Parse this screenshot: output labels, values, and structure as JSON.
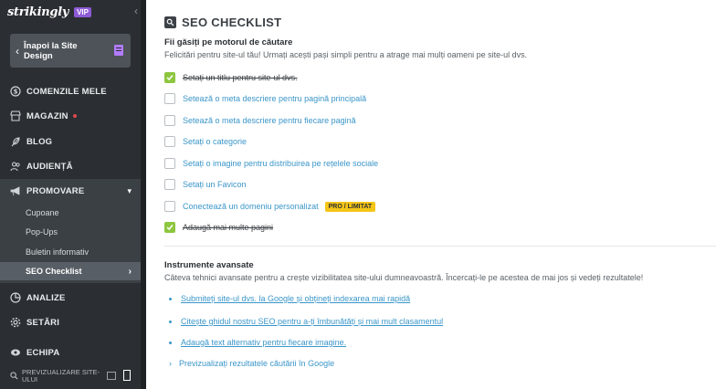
{
  "sidebar": {
    "brand": "strikingly",
    "vip": "VIP",
    "back_label": "Înapoi la Site Design",
    "nav": {
      "orders": "COMENZILE MELE",
      "store": "MAGAZIN",
      "blog": "BLOG",
      "audience": "AUDIENȚĂ",
      "promote": "PROMOVARE",
      "analytics": "ANALIZE",
      "settings": "SETĂRI",
      "team": "ECHIPA"
    },
    "promote_sub": [
      "Cupoane",
      "Pop-Ups",
      "Buletin informativ",
      "SEO Checklist"
    ],
    "preview_label": "PREVIZUALIZARE SITE-ULUI"
  },
  "main": {
    "title": "SEO CHECKLIST",
    "section1": {
      "title": "Fii găsiți pe motorul de căutare",
      "desc": "Felicitări pentru site-ul tău! Urmați acești pași simpli pentru a atrage mai mulți oameni pe site-ul dvs.",
      "items": [
        {
          "label": "Setați un titlu pentru site-ul dvs.",
          "done": true
        },
        {
          "label": "Setează o meta descriere pentru pagină principală",
          "done": false
        },
        {
          "label": "Setează o meta descriere pentru fiecare pagină",
          "done": false
        },
        {
          "label": "Setați o categorie",
          "done": false
        },
        {
          "label": "Setați o imagine pentru distribuirea pe rețelele sociale",
          "done": false
        },
        {
          "label": "Setați un Favicon",
          "done": false
        },
        {
          "label": "Conectează un domeniu personalizat",
          "done": false,
          "badge": "PRO / LIMITAT"
        },
        {
          "label": "Adaugă mai multe pagini",
          "done": true
        }
      ]
    },
    "section2": {
      "title": "Instrumente avansate",
      "desc": "Câteva tehnici avansate pentru a crește vizibilitatea site-ului dumneavoastră. Încercați-le pe acestea de mai jos și vedeți rezultatele!",
      "links": [
        "Submiteți site-ul dvs. la Google și obțineți indexarea mai rapidă",
        "Citește ghidul nostru SEO pentru a-ți îmbunătăți și mai mult clasamentul",
        "Adaugă text alternativ pentru fiecare imagine."
      ],
      "expand_label": "Previzualizați rezultatele căutării în Google"
    }
  },
  "colors": {
    "sidebar_bg": "#2b2f33",
    "accent_link": "#3b96c9",
    "check_green": "#8dc63f",
    "pro_badge": "#f5c518",
    "vip_purple": "#8e5bd6"
  }
}
